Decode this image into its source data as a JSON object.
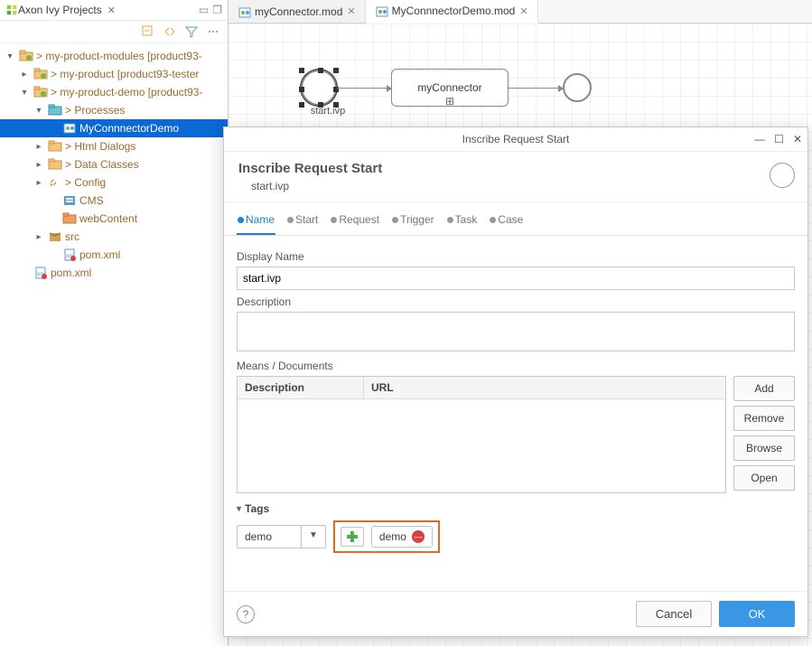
{
  "sidebar": {
    "title": "Axon Ivy Projects",
    "tree": [
      {
        "id": "root",
        "indent": 0,
        "arrow": "open",
        "label": "> my-product-modules ",
        "suffix": "[product93-",
        "icon": "project"
      },
      {
        "id": "myproduct",
        "indent": 1,
        "arrow": "closed",
        "label": "> my-product ",
        "suffix": "[product93-tester",
        "icon": "project"
      },
      {
        "id": "demo",
        "indent": 1,
        "arrow": "open",
        "label": "> my-product-demo ",
        "suffix": "[product93-",
        "icon": "project"
      },
      {
        "id": "processes",
        "indent": 2,
        "arrow": "open",
        "label": "> Processes",
        "suffix": "",
        "icon": "folder-cyan"
      },
      {
        "id": "connectordemo",
        "indent": 3,
        "arrow": "none",
        "label": "MyConnnectorDemo",
        "suffix": "",
        "icon": "process",
        "selected": true
      },
      {
        "id": "htmldialogs",
        "indent": 2,
        "arrow": "closed",
        "label": "> Html Dialogs",
        "suffix": "",
        "icon": "folder"
      },
      {
        "id": "dataclasses",
        "indent": 2,
        "arrow": "closed",
        "label": "> Data Classes",
        "suffix": "",
        "icon": "folder"
      },
      {
        "id": "config",
        "indent": 2,
        "arrow": "closed",
        "label": "> Config",
        "suffix": "",
        "icon": "wrench"
      },
      {
        "id": "cms",
        "indent": 3,
        "arrow": "none",
        "label": "CMS",
        "suffix": "",
        "icon": "cms"
      },
      {
        "id": "webcontent",
        "indent": 3,
        "arrow": "none",
        "label": "webContent",
        "suffix": "",
        "icon": "folder-orange"
      },
      {
        "id": "src",
        "indent": 2,
        "arrow": "closed",
        "label": "src",
        "suffix": "",
        "icon": "package"
      },
      {
        "id": "pomxml",
        "indent": 3,
        "arrow": "none",
        "label": "pom.xml",
        "suffix": "",
        "icon": "xml"
      },
      {
        "id": "pomxml2",
        "indent": 1,
        "arrow": "none",
        "label": "pom.xml",
        "suffix": "",
        "icon": "xml"
      }
    ]
  },
  "editor_tabs": [
    {
      "label": "myConnector.mod",
      "active": false
    },
    {
      "label": "MyConnnectorDemo.mod",
      "active": true
    }
  ],
  "bpmn": {
    "start_caption": "start.ivp",
    "task_label": "myConnector"
  },
  "dialog": {
    "window_title": "Inscribe Request Start",
    "title": "Inscribe Request Start",
    "subtitle": "start.ivp",
    "tabs": [
      "Name",
      "Start",
      "Request",
      "Trigger",
      "Task",
      "Case"
    ],
    "active_tab": 0,
    "display_name_label": "Display Name",
    "display_name_value": "start.ivp",
    "description_label": "Description",
    "description_value": "",
    "means_label": "Means / Documents",
    "means_cols": {
      "description": "Description",
      "url": "URL"
    },
    "means_buttons": [
      "Add",
      "Remove",
      "Browse",
      "Open"
    ],
    "tags_label": "Tags",
    "tag_input": "demo",
    "tags": [
      "demo"
    ],
    "footer": {
      "cancel": "Cancel",
      "ok": "OK"
    }
  }
}
